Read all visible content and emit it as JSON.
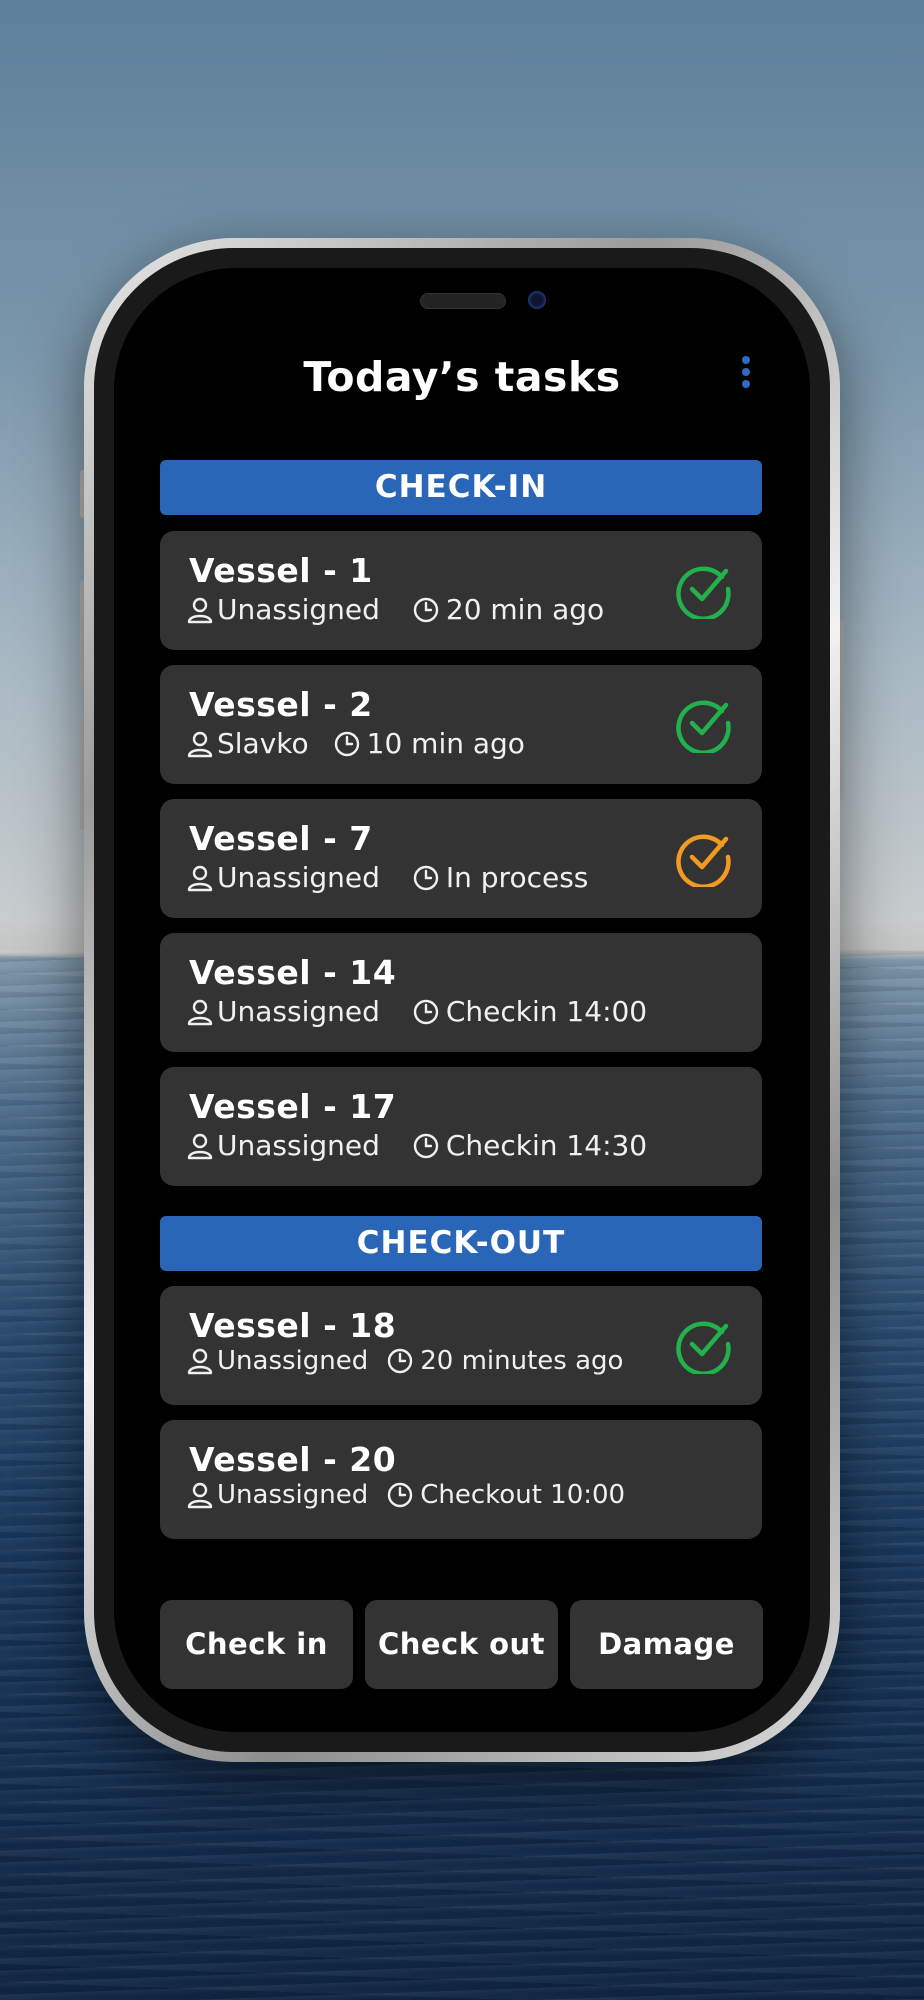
{
  "screen": {
    "title": "Today’s tasks"
  },
  "checkin": {
    "header": "CHECK-IN",
    "items": [
      {
        "name": "Vessel - 1",
        "assignee": "Unassigned",
        "time": "20 min ago",
        "status": "done"
      },
      {
        "name": "Vessel - 2",
        "assignee": "Slavko",
        "time": "10 min ago",
        "status": "done"
      },
      {
        "name": "Vessel - 7",
        "assignee": "Unassigned",
        "time": "In process",
        "status": "in-progress"
      },
      {
        "name": "Vessel - 14",
        "assignee": "Unassigned",
        "time": "Checkin 14:00",
        "status": "none"
      },
      {
        "name": "Vessel - 17",
        "assignee": "Unassigned",
        "time": "Checkin 14:30",
        "status": "none"
      }
    ]
  },
  "checkout": {
    "header": "CHECK-OUT",
    "items": [
      {
        "name": "Vessel - 18",
        "assignee": "Unassigned",
        "time": "20 minutes ago",
        "status": "done"
      },
      {
        "name": "Vessel - 20",
        "assignee": "Unassigned",
        "time": "Checkout 10:00",
        "status": "none"
      }
    ]
  },
  "bottom_bar": {
    "check_in_label": "Check in",
    "check_out_label": "Check out",
    "damage_label": "Damage"
  },
  "icons": {
    "menu": "more-vertical-icon",
    "user": "user-icon",
    "clock": "clock-icon",
    "status_done": "check-circle-icon",
    "status_in_progress": "check-circle-icon"
  },
  "colors": {
    "section_header": "#2a66b8",
    "card_bg": "#333333",
    "done": "#22b14c",
    "in_progress": "#f29b20",
    "menu_dots": "#2f6bc6"
  }
}
